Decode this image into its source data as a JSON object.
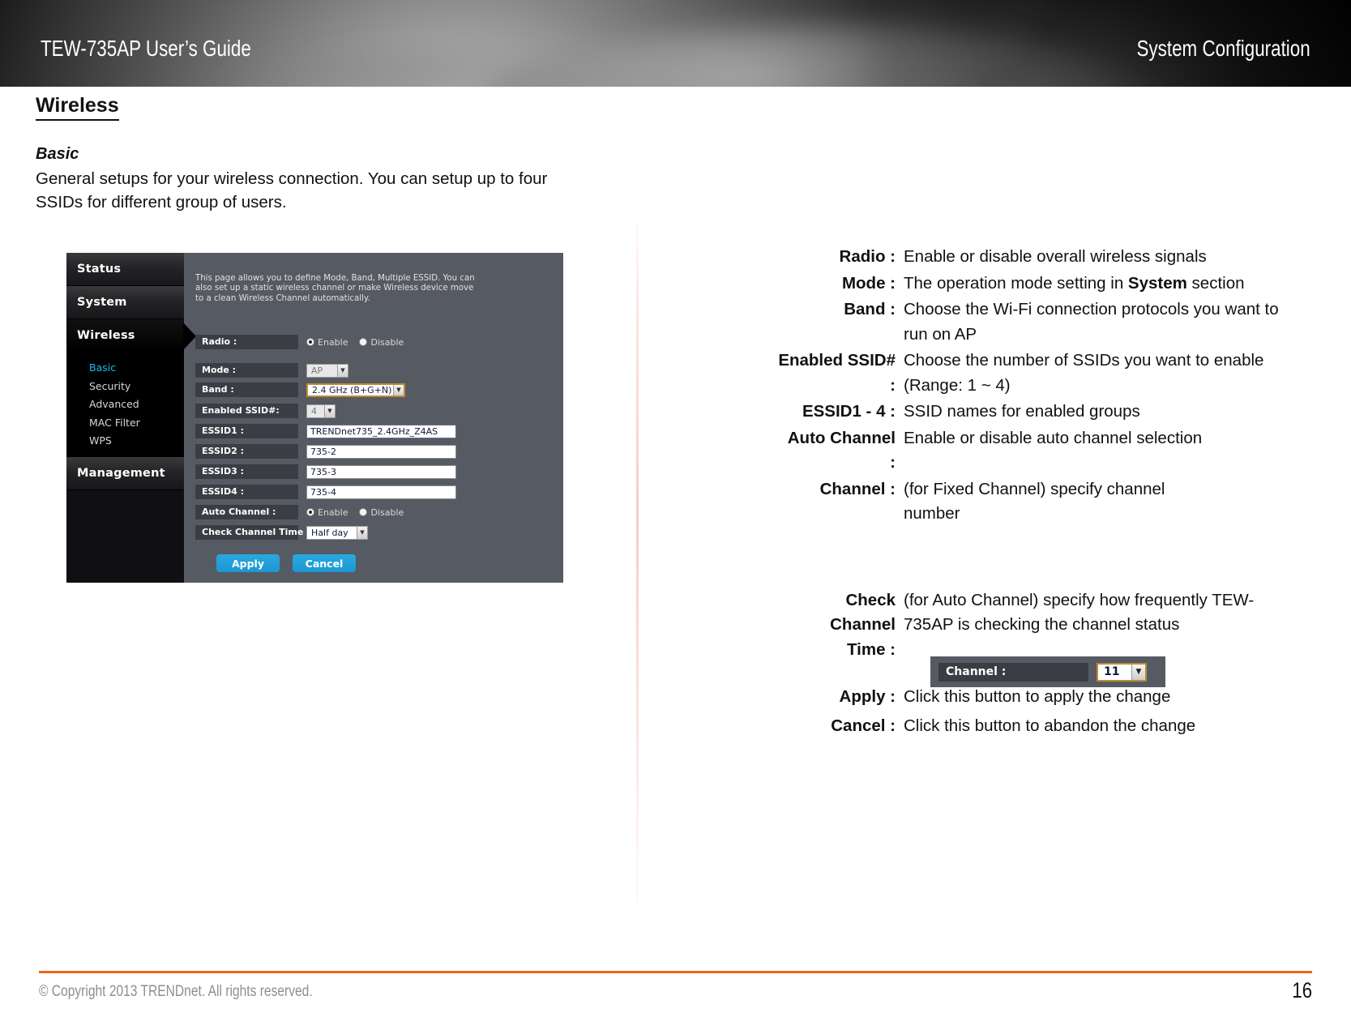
{
  "header": {
    "left_title": "TEW-735AP User’s Guide",
    "right_title": "System Configuration"
  },
  "content": {
    "section_title": "Wireless",
    "subsection_title": "Basic",
    "intro_paragraph": "General setups for your wireless connection. You can setup up to four SSIDs for different group of users."
  },
  "router_ui": {
    "sidebar": {
      "top_items": [
        {
          "label": "Status",
          "active": false
        },
        {
          "label": "System",
          "active": false
        },
        {
          "label": "Wireless",
          "active": true
        },
        {
          "label": "Management",
          "active": false
        }
      ],
      "wireless_submenu": [
        {
          "label": "Basic",
          "selected": true
        },
        {
          "label": "Security",
          "selected": false
        },
        {
          "label": "Advanced",
          "selected": false
        },
        {
          "label": "MAC Filter",
          "selected": false
        },
        {
          "label": "WPS",
          "selected": false
        }
      ]
    },
    "description": "This page allows you to define Mode, Band, Multiple ESSID. You can also set up a static wireless channel or make Wireless device move to a clean Wireless Channel automatically.",
    "fields": {
      "radio": {
        "label": "Radio :",
        "options": [
          "Enable",
          "Disable"
        ],
        "selected": "Disable"
      },
      "mode": {
        "label": "Mode :",
        "value": "AP"
      },
      "band": {
        "label": "Band :",
        "value": "2.4 GHz (B+G+N)"
      },
      "enabled_ssid": {
        "label": "Enabled SSID#:",
        "value": "4"
      },
      "essid1": {
        "label": "ESSID1 :",
        "value": "TRENDnet735_2.4GHz_Z4AS"
      },
      "essid2": {
        "label": "ESSID2 :",
        "value": "735-2"
      },
      "essid3": {
        "label": "ESSID3 :",
        "value": "735-3"
      },
      "essid4": {
        "label": "ESSID4 :",
        "value": "735-4"
      },
      "auto_channel": {
        "label": "Auto Channel :",
        "options": [
          "Enable",
          "Disable"
        ],
        "selected": "Disable"
      },
      "check_channel_time": {
        "label": "Check Channel Time :",
        "value": "Half day"
      }
    },
    "buttons": {
      "apply": "Apply",
      "cancel": "Cancel"
    }
  },
  "descriptions": [
    {
      "term": "Radio :",
      "text": "Enable or disable overall wireless signals",
      "bold_word": ""
    },
    {
      "term": "Mode :",
      "text_pre": "The operation mode setting in ",
      "bold_word": "System",
      "text_post": " section"
    },
    {
      "term": "Band :",
      "text": "Choose the Wi-Fi connection protocols you want to run on AP"
    },
    {
      "term": "Enabled SSID# :",
      "text": "Choose the number of SSIDs you want to enable (Range: 1 ~ 4)"
    },
    {
      "term": "ESSID1 - 4 :",
      "text": "SSID names for enabled groups"
    },
    {
      "term": "Auto Channel :",
      "text": "Enable or disable auto channel selection"
    },
    {
      "term": "Channel :",
      "text": "(for Fixed Channel) specify channel number"
    },
    {
      "term": "Check Channel\nTime :",
      "text": "(for Auto Channel) specify how frequently TEW-735AP is checking the channel status"
    },
    {
      "term": "Apply :",
      "text": "Click this button to apply the change"
    },
    {
      "term": "Cancel :",
      "text": "Click this button to abandon the change"
    }
  ],
  "channel_inset": {
    "label": "Channel :",
    "value": "11"
  },
  "footer": {
    "copyright": "© Copyright 2013 TRENDnet. All rights reserved.",
    "page_number": "16"
  },
  "colors": {
    "accent_orange": "#e8691c",
    "router_blue": "#29a9e0",
    "router_cyan": "#1eb9f0",
    "router_bg": "#565a63"
  }
}
